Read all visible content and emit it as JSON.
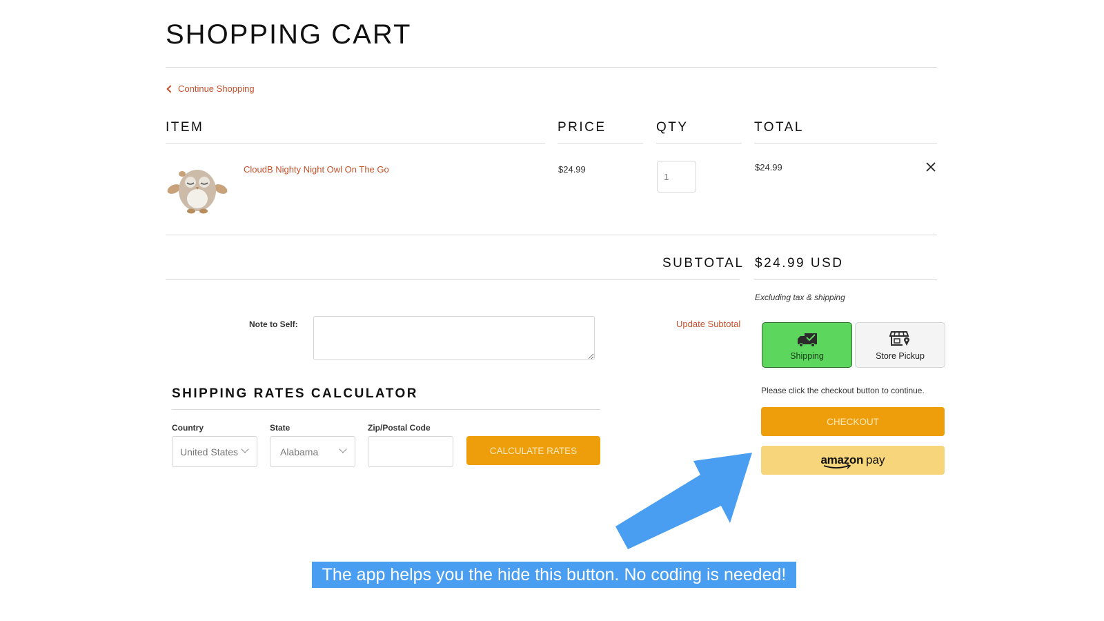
{
  "page": {
    "title": "SHOPPING CART",
    "continue_shopping": "Continue Shopping"
  },
  "columns": {
    "item": "ITEM",
    "price": "PRICE",
    "qty": "QTY",
    "total": "TOTAL"
  },
  "cart_items": [
    {
      "name": "CloudB Nighty Night Owl On The Go",
      "price": "$24.99",
      "quantity": "1",
      "total": "$24.99",
      "image_icon": "owl-plush-image"
    }
  ],
  "summary": {
    "subtotal_label": "SUBTOTAL",
    "subtotal_value": "$24.99 USD",
    "excluding_note": "Excluding tax & shipping",
    "update_subtotal": "Update Subtotal"
  },
  "note": {
    "label": "Note to Self:",
    "value": ""
  },
  "delivery_methods": [
    {
      "label": "Shipping",
      "icon": "truck-check-icon",
      "selected": true
    },
    {
      "label": "Store Pickup",
      "icon": "store-pin-icon",
      "selected": false
    }
  ],
  "checkout": {
    "instruction": "Please click the checkout button to continue.",
    "checkout_label": "CHECKOUT",
    "amazon_label_brand": "amazon",
    "amazon_label_pay": "pay"
  },
  "shipping_calculator": {
    "title": "SHIPPING RATES CALCULATOR",
    "country_label": "Country",
    "country_value": "United States",
    "state_label": "State",
    "state_value": "Alabama",
    "zip_label": "Zip/Postal Code",
    "zip_value": "",
    "calculate_label": "CALCULATE RATES"
  },
  "annotation": {
    "banner_text": "The app helps you the hide this button.  No coding is needed!"
  },
  "colors": {
    "accent_link": "#c4502b",
    "checkout_orange": "#ee9e0a",
    "amazon_yellow": "#f6d57b",
    "shipping_green": "#5dd65d",
    "annotation_blue": "#4a9ef2"
  }
}
